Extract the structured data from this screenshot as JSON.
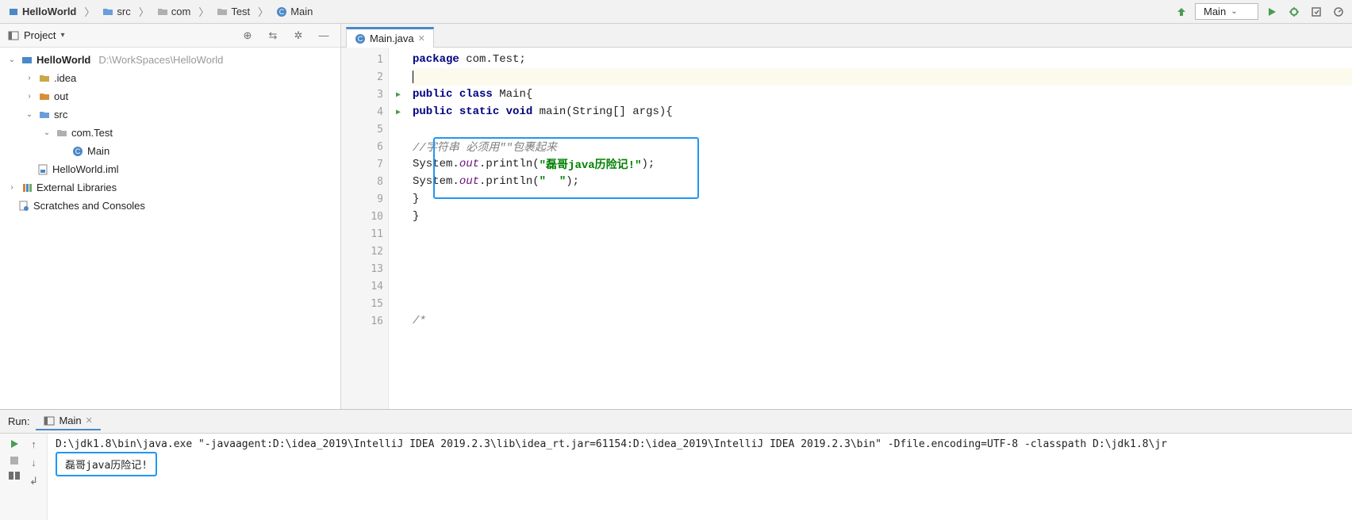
{
  "breadcrumb": [
    {
      "label": "HelloWorld",
      "bold": true,
      "icon": "project"
    },
    {
      "label": "src",
      "icon": "folder-blue"
    },
    {
      "label": "com",
      "icon": "folder-gray"
    },
    {
      "label": "Test",
      "icon": "folder-gray"
    },
    {
      "label": "Main",
      "icon": "class"
    }
  ],
  "runConfig": {
    "selected": "Main"
  },
  "projectPanel": {
    "title": "Project"
  },
  "tree": {
    "root": {
      "name": "HelloWorld",
      "path": "D:\\WorkSpaces\\HelloWorld"
    },
    "idea": ".idea",
    "out": "out",
    "src": "src",
    "pkg": "com.Test",
    "mainClass": "Main",
    "iml": "HelloWorld.iml",
    "extLib": "External Libraries",
    "scratches": "Scratches and Consoles"
  },
  "editor": {
    "tab": "Main.java",
    "lines": {
      "l1_pkg": "package",
      "l1_rest": " com.Test;",
      "l3_pub": "public",
      "l3_class": " class",
      "l3_rest": " Main{",
      "l4_pub": "public",
      "l4_static": " static",
      "l4_void": " void",
      "l4_rest": " main(String[] args){",
      "l6_comment": "//字符串 必须用\"\"包裹起来",
      "l7_a": "System.",
      "l7_out": "out",
      "l7_b": ".println(",
      "l7_str": "\"磊哥java历险记!\"",
      "l7_c": ");",
      "l8_a": "System.",
      "l8_out": "out",
      "l8_b": ".println(",
      "l8_str": "\"  \"",
      "l8_c": ");",
      "l9": "}",
      "l10": "}",
      "l16": "/*"
    },
    "lineNumbers": [
      "1",
      "2",
      "3",
      "4",
      "5",
      "6",
      "7",
      "8",
      "9",
      "10",
      "11",
      "12",
      "13",
      "14",
      "15",
      "16",
      ""
    ]
  },
  "run": {
    "label": "Run:",
    "tab": "Main",
    "cmd": "D:\\jdk1.8\\bin\\java.exe \"-javaagent:D:\\idea_2019\\IntelliJ IDEA 2019.2.3\\lib\\idea_rt.jar=61154:D:\\idea_2019\\IntelliJ IDEA 2019.2.3\\bin\" -Dfile.encoding=UTF-8 -classpath D:\\jdk1.8\\jr",
    "out1": "磊哥java历险记!"
  }
}
